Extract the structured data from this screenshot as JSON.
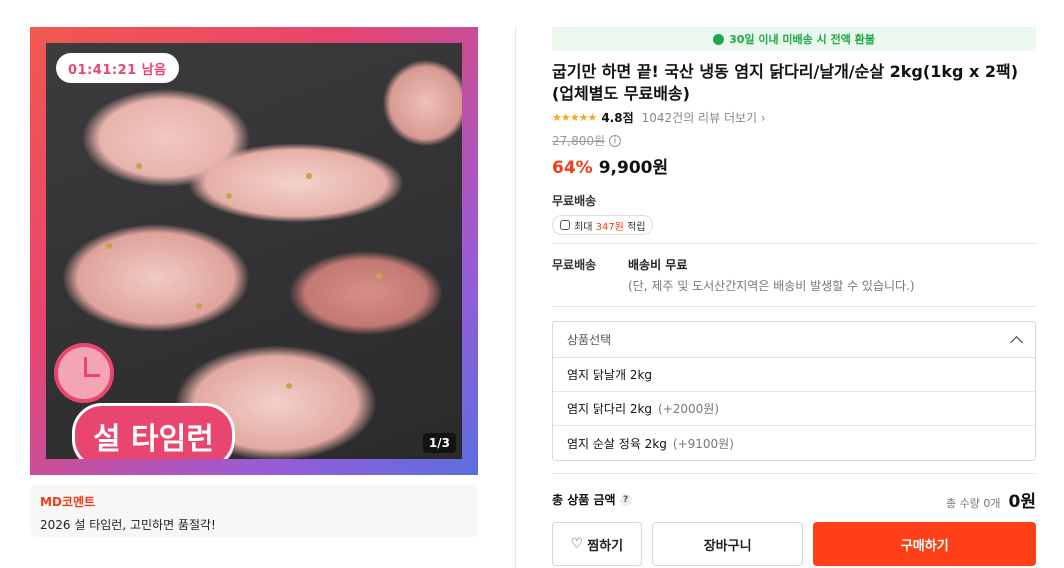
{
  "image_panel": {
    "timer": "01:41:21 남음",
    "sale_logo_text": "설 타임런",
    "page_indicator": "1/3"
  },
  "md_comment": {
    "title": "MD코멘트",
    "text": "2026 설 타임런, 고민하면 품절각!"
  },
  "refund_banner": "30일 이내 미배송 시 전액 환불",
  "product": {
    "title": "굽기만 하면 끝! 국산 냉동 염지 닭다리/날개/순살 2kg(1kg x 2팩)(업체별도 무료배송)",
    "stars": "★★★★★",
    "rating": "4.8점",
    "review_link": "1042건의 리뷰 더보기 ›",
    "list_price": "27,800원",
    "discount": "64%",
    "price": "9,900원",
    "shipping_label": "무료배송",
    "points_prefix": "최대 ",
    "points_value": "347원",
    "points_suffix": " 적립"
  },
  "shipping": {
    "key": "무료배송",
    "fee": "배송비 무료",
    "note": "(단, 제주 및 도서산간지역은 배송비 발생할 수 있습니다.)"
  },
  "options": {
    "placeholder": "상품선택",
    "items": [
      {
        "name": "염지 닭날개 2kg",
        "extra": ""
      },
      {
        "name": "염지 닭다리 2kg",
        "extra": "(+2000원)"
      },
      {
        "name": "염지 순살 정육 2kg",
        "extra": "(+9100원)"
      }
    ]
  },
  "total": {
    "label": "총 상품 금액",
    "help": "?",
    "quantity": "총 수량 0개",
    "amount": "0원"
  },
  "buttons": {
    "wish": "찜하기",
    "cart": "장바구니",
    "buy": "구매하기"
  },
  "colors": {
    "accent": "#f03c19",
    "buy_button": "#ff3f17",
    "refund_green": "#1ea848",
    "sale_pink": "#e8456f"
  }
}
